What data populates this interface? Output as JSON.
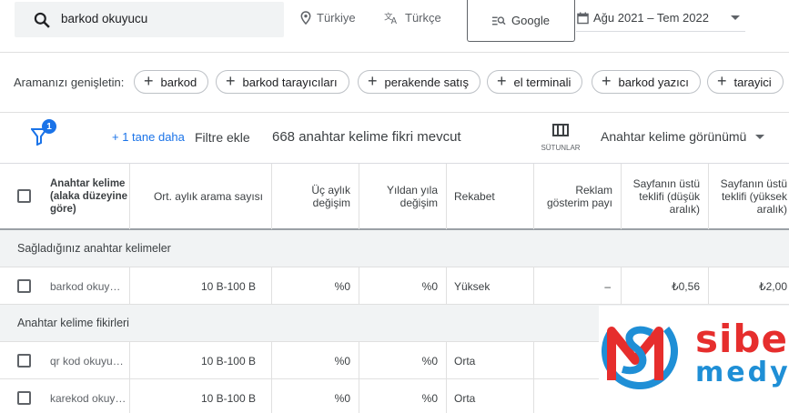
{
  "search": {
    "value": "barkod okuyucu"
  },
  "targeting": {
    "location": "Türkiye",
    "language": "Türkçe",
    "network": "Google",
    "date_range": "Ağu 2021 – Tem 2022"
  },
  "broaden": {
    "label": "Aramanızı genişletin:",
    "chips": [
      "barkod",
      "barkod tarayıcıları",
      "perakende satış",
      "el terminali",
      "barkod yazıcı",
      "tarayici"
    ]
  },
  "filters": {
    "badge_count": "1",
    "more_link": "+ 1 tane daha",
    "add_filter": "Filtre ekle",
    "idea_count": "668 anahtar kelime fikri mevcut",
    "columns_label": "SÜTUNLAR",
    "view_label": "Anahtar kelime görünümü"
  },
  "table": {
    "headers": {
      "keyword": "Anahtar kelime (alaka düzeyine göre)",
      "avg_searches": "Ort. aylık arama sayısı",
      "three_month": "Üç aylık değişim",
      "yoy": "Yıldan yıla değişim",
      "competition": "Rekabet",
      "impression_share": "Reklam gösterim payı",
      "bid_low": "Sayfanın üstü teklifi (düşük aralık)",
      "bid_high": "Sayfanın üstü teklifi (yüksek aralık)"
    },
    "section_provided": "Sağladığınız anahtar kelimeler",
    "section_ideas": "Anahtar kelime fikirleri",
    "rows": [
      {
        "keyword": "barkod okuy…",
        "avg": "10 B-100 B",
        "three": "%0",
        "yoy": "%0",
        "comp": "Yüksek",
        "share": "–",
        "low": "₺0,56",
        "high": "₺2,00"
      },
      {
        "keyword": "qr kod okuyu…",
        "avg": "10 B-100 B",
        "three": "%0",
        "yoy": "%0",
        "comp": "Orta",
        "share": "",
        "low": "",
        "high": ""
      },
      {
        "keyword": "karekod okuy…",
        "avg": "10 B-100 B",
        "three": "%0",
        "yoy": "%0",
        "comp": "Orta",
        "share": "",
        "low": "",
        "high": ""
      }
    ]
  },
  "logo": {
    "word1": "siber",
    "word2": "medya",
    "colors": {
      "red": "#e62e2d",
      "blue": "#1f8fd6"
    }
  }
}
